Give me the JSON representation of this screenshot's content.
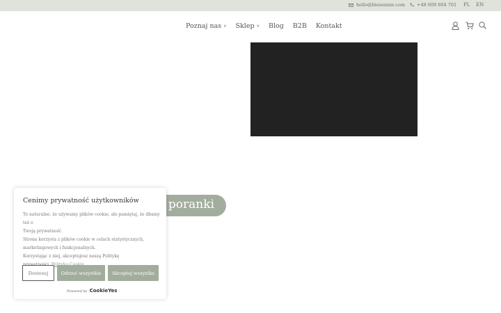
{
  "topbar": {
    "email": "hello@biosennie.com",
    "phone": "+48 609 604 701",
    "languages": [
      "PL",
      "EN"
    ],
    "icons": {
      "email": "envelope-icon",
      "phone": "phone-icon"
    },
    "background": "#dfe3dc"
  },
  "nav": {
    "items": [
      {
        "label": "Poznaj nas",
        "has_dropdown": true
      },
      {
        "label": "Sklep",
        "has_dropdown": true
      },
      {
        "label": "Blog",
        "has_dropdown": false
      },
      {
        "label": "B2B",
        "has_dropdown": false
      },
      {
        "label": "Kontakt",
        "has_dropdown": false
      }
    ],
    "icons": [
      "user-icon",
      "cart-icon",
      "search-icon"
    ]
  },
  "hero": {
    "video_background": "#222222",
    "pill_text": "la poranki",
    "accent": "#a3ad9e"
  },
  "cookie_banner": {
    "title": "Cenimy prywatność użytkowników",
    "line1": "To naturalne, że używamy plików cookie, ale pamiętaj, że dbamy też o",
    "line2": "Twoją prywatność.",
    "line3": "Strona korzysta z plików cookie w celach statystycznych,",
    "line4": "marketingowych i funkcjonalnych.",
    "line5": "Korzystając z niej, akceptujesz naszą Politykę",
    "line6_text": "prywatności.",
    "policy_link": "Polityka Cookie",
    "buttons": {
      "customize": "Dostosuj",
      "reject": "Odrzuć wszystkie",
      "accept": "Akceptuj wszystko"
    },
    "powered_by": "Powered by",
    "brand": "CookieYes"
  }
}
